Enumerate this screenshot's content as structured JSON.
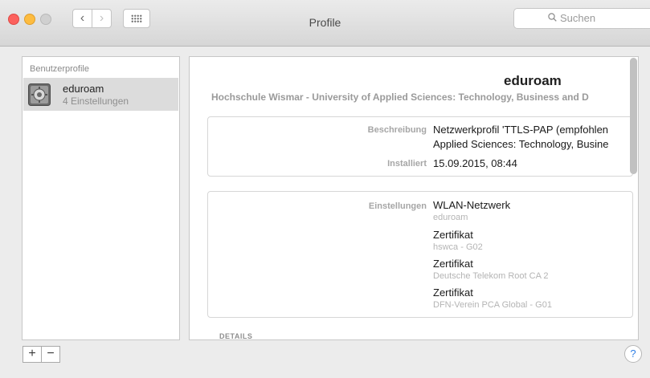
{
  "window": {
    "title": "Profile"
  },
  "search": {
    "placeholder": "Suchen"
  },
  "sidebar": {
    "header": "Benutzerprofile",
    "items": [
      {
        "name": "eduroam",
        "subtitle": "4 Einstellungen",
        "icon": "gear-profile-icon"
      }
    ]
  },
  "detail": {
    "title": "eduroam",
    "organization": "Hochschule Wismar - University of Applied Sciences: Technology, Business and D",
    "description_label": "Beschreibung",
    "description_lines": [
      "Netzwerkprofil 'TTLS-PAP (empfohlen",
      "Applied Sciences: Technology, Busine"
    ],
    "installed_label": "Installiert",
    "installed_value": "15.09.2015, 08:44",
    "settings_label": "Einstellungen",
    "settings": [
      {
        "type": "WLAN-Netzwerk",
        "detail": "eduroam"
      },
      {
        "type": "Zertifikat",
        "detail": "hswca - G02"
      },
      {
        "type": "Zertifikat",
        "detail": "Deutsche Telekom Root CA 2"
      },
      {
        "type": "Zertifikat",
        "detail": "DFN-Verein PCA Global - G01"
      }
    ],
    "details_header": "DETAILS"
  },
  "footer": {
    "add_label": "+",
    "remove_label": "−",
    "help_label": "?"
  },
  "colors": {
    "close": "#fc615d",
    "minimize": "#fdbc40",
    "accent": "#2f7fe5"
  }
}
